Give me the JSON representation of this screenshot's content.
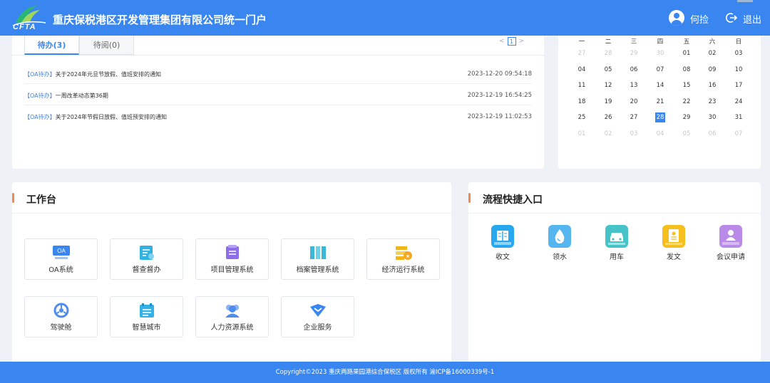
{
  "header": {
    "logo_text": "CFTA",
    "title": "重庆保税港区开发管理集团有限公司统一门户",
    "user_name": "何捡",
    "logout_label": "退出"
  },
  "todo": {
    "tabs": [
      {
        "label": "待办(3)",
        "active": true
      },
      {
        "label": "待阅(0)",
        "active": false
      }
    ],
    "pager": {
      "prev": "<",
      "page": "1",
      "next": ">"
    },
    "items": [
      {
        "tag": "【OA待办】",
        "title": "关于2024年元旦节放假、值班安排的通知",
        "time": "2023-12-20 09:54:18"
      },
      {
        "tag": "【OA待办】",
        "title": "一周改革动态第36期",
        "time": "2023-12-19 16:54:25"
      },
      {
        "tag": "【OA待办】",
        "title": "关于2024年节假日放假、值班预安排的通知",
        "time": "2023-12-19 11:02:53"
      }
    ]
  },
  "calendar": {
    "weekdays": [
      "一",
      "二",
      "三",
      "四",
      "五",
      "六",
      "日"
    ],
    "weeks": [
      [
        {
          "d": "27",
          "m": true
        },
        {
          "d": "28",
          "m": true
        },
        {
          "d": "29",
          "m": true
        },
        {
          "d": "30",
          "m": true
        },
        {
          "d": "01"
        },
        {
          "d": "02"
        },
        {
          "d": "03"
        }
      ],
      [
        {
          "d": "04"
        },
        {
          "d": "05"
        },
        {
          "d": "06"
        },
        {
          "d": "07"
        },
        {
          "d": "08"
        },
        {
          "d": "09"
        },
        {
          "d": "10"
        }
      ],
      [
        {
          "d": "11"
        },
        {
          "d": "12"
        },
        {
          "d": "13"
        },
        {
          "d": "14"
        },
        {
          "d": "15"
        },
        {
          "d": "16"
        },
        {
          "d": "17"
        }
      ],
      [
        {
          "d": "18"
        },
        {
          "d": "19"
        },
        {
          "d": "20"
        },
        {
          "d": "21"
        },
        {
          "d": "22"
        },
        {
          "d": "23"
        },
        {
          "d": "24"
        }
      ],
      [
        {
          "d": "25"
        },
        {
          "d": "26"
        },
        {
          "d": "27"
        },
        {
          "d": "28",
          "today": true
        },
        {
          "d": "29"
        },
        {
          "d": "30"
        },
        {
          "d": "31"
        }
      ],
      [
        {
          "d": "01",
          "m": true
        },
        {
          "d": "02",
          "m": true
        },
        {
          "d": "03",
          "m": true
        },
        {
          "d": "04",
          "m": true
        },
        {
          "d": "05",
          "m": true
        },
        {
          "d": "06",
          "m": true
        },
        {
          "d": "07",
          "m": true
        }
      ]
    ]
  },
  "workbench": {
    "title": "工作台",
    "tiles": [
      {
        "label": "OA系统",
        "icon": "oa-icon",
        "icon_text": "OA",
        "color": "#3a86f0"
      },
      {
        "label": "督查督办",
        "icon": "supervise-icon",
        "color": "#33b1e0"
      },
      {
        "label": "项目管理系统",
        "icon": "project-icon",
        "color": "#8e6ee8"
      },
      {
        "label": "档案管理系统",
        "icon": "archive-icon",
        "color": "#3bb8d8"
      },
      {
        "label": "经济运行系统",
        "icon": "economy-icon",
        "color": "#f2b51c"
      },
      {
        "label": "驾驶舱",
        "icon": "cockpit-icon",
        "color": "#4f8cf0"
      },
      {
        "label": "智慧城市",
        "icon": "smart-city-icon",
        "color": "#35b0e6"
      },
      {
        "label": "人力资源系统",
        "icon": "hr-icon",
        "color": "#4f8cf0"
      },
      {
        "label": "企业服务",
        "icon": "enterprise-icon",
        "color": "#3a86f0"
      }
    ]
  },
  "flow": {
    "title": "流程快捷入口",
    "items": [
      {
        "label": "收文",
        "icon": "receive-doc-icon",
        "color": "#27a8ee"
      },
      {
        "label": "领水",
        "icon": "water-icon",
        "color": "#55b6ef"
      },
      {
        "label": "用车",
        "icon": "car-icon",
        "color": "#45c3c7"
      },
      {
        "label": "发文",
        "icon": "send-doc-icon",
        "color": "#f5bf1d"
      },
      {
        "label": "会议申请",
        "icon": "meeting-icon",
        "color": "#b98ae8"
      }
    ]
  },
  "footer": {
    "text": "Copyright©2023 重庆两路果园港综合保税区 版权所有 渝ICP备16000339号-1"
  }
}
